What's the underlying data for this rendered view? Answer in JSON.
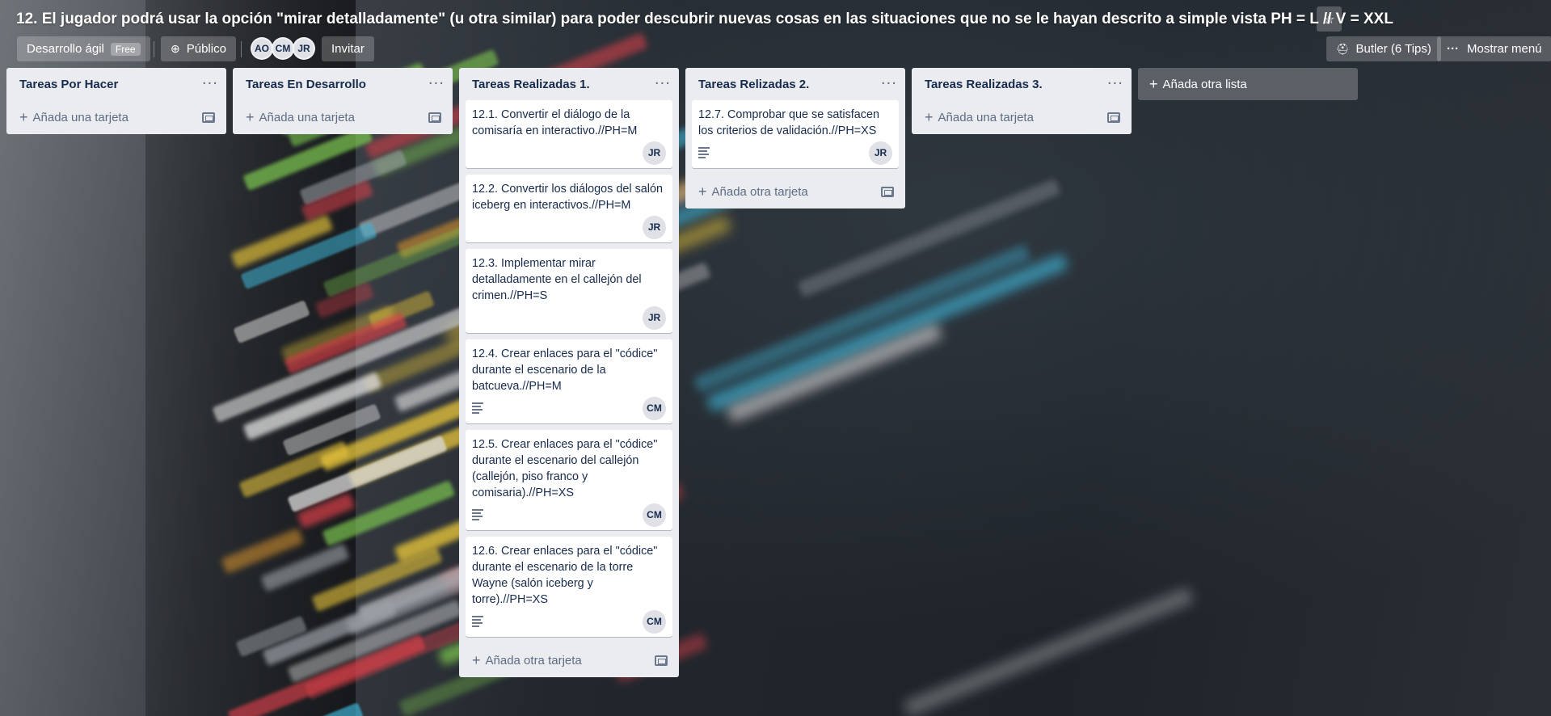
{
  "board": {
    "title": "12. El jugador podrá usar la opción \"mirar detalladamente\" (u otra similar) para poder descubrir nuevas cosas en las situaciones que no se le hayan descrito a simple vista PH = L // V = XXL",
    "team_name": "Desarrollo ágil",
    "team_badge": "Free",
    "visibility": "Público",
    "members": [
      "AO",
      "CM",
      "JR"
    ],
    "invite_label": "Invitar",
    "butler_label": "Butler (6 Tips)",
    "menu_label": "Mostrar menú",
    "add_list_label": "Añada otra lista"
  },
  "lists": [
    {
      "title": "Tareas Por Hacer",
      "add_label": "Añada una tarjeta",
      "cards": []
    },
    {
      "title": "Tareas En Desarrollo",
      "add_label": "Añada una tarjeta",
      "cards": []
    },
    {
      "title": "Tareas Realizadas 1.",
      "add_label": "Añada otra tarjeta",
      "cards": [
        {
          "text": "12.1. Convertir el diálogo de la comisaría en interactivo.//PH=M",
          "member": "JR",
          "has_description": false
        },
        {
          "text": "12.2. Convertir los diálogos del salón iceberg en interactivos.//PH=M",
          "member": "JR",
          "has_description": false
        },
        {
          "text": "12.3. Implementar mirar detalladamente en el callejón del crimen.//PH=S",
          "member": "JR",
          "has_description": false
        },
        {
          "text": "12.4. Crear enlaces para el \"códice\" durante el escenario de la batcueva.//PH=M",
          "member": "CM",
          "has_description": true
        },
        {
          "text": "12.5. Crear enlaces para el \"códice\" durante el escenario del callejón (callejón, piso franco y comisaria).//PH=XS",
          "member": "CM",
          "has_description": true
        },
        {
          "text": "12.6. Crear enlaces para el \"códice\" durante el escenario de la torre Wayne (salón iceberg y torre).//PH=XS",
          "member": "CM",
          "has_description": true
        }
      ]
    },
    {
      "title": "Tareas Relizadas 2.",
      "add_label": "Añada otra tarjeta",
      "cards": [
        {
          "text": "12.7. Comprobar que se satisfacen los criterios de validación.//PH=XS",
          "member": "JR",
          "has_description": true
        }
      ]
    },
    {
      "title": "Tareas Realizadas 3.",
      "add_label": "Añada una tarjeta",
      "cards": []
    }
  ],
  "icons": {
    "star": "star-icon",
    "globe": "globe-icon",
    "butler": "butler-icon",
    "menu": "ellipsis-icon",
    "plus": "plus-icon",
    "template": "card-template-icon",
    "description": "description-icon"
  }
}
